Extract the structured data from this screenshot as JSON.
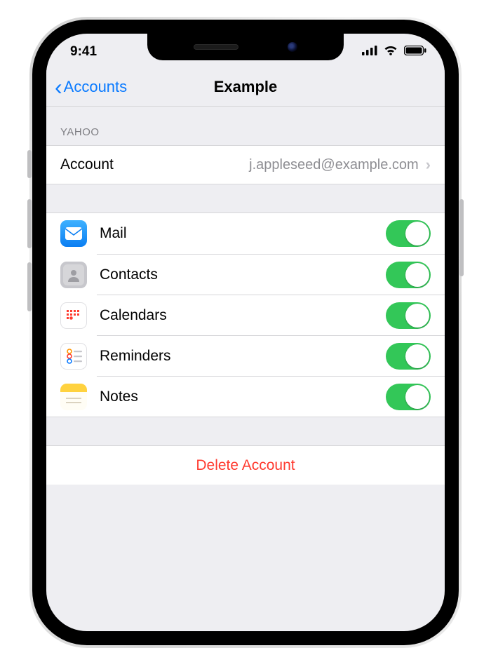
{
  "status": {
    "time": "9:41"
  },
  "nav": {
    "back_label": "Accounts",
    "title": "Example"
  },
  "account_section": {
    "header": "YAHOO",
    "row_label": "Account",
    "row_value": "j.appleseed@example.com"
  },
  "services": [
    {
      "id": "mail",
      "label": "Mail",
      "on": true
    },
    {
      "id": "contacts",
      "label": "Contacts",
      "on": true
    },
    {
      "id": "calendars",
      "label": "Calendars",
      "on": true
    },
    {
      "id": "reminders",
      "label": "Reminders",
      "on": true
    },
    {
      "id": "notes",
      "label": "Notes",
      "on": true
    }
  ],
  "actions": {
    "delete_label": "Delete Account"
  }
}
